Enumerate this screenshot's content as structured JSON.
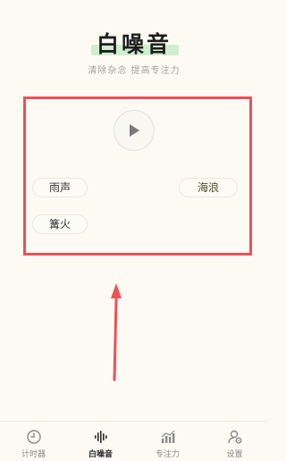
{
  "header": {
    "title": "白噪音",
    "subtitle": "清除杂念 提高专注力"
  },
  "player": {
    "play_icon": "play-icon",
    "sounds": [
      {
        "label": "雨声"
      },
      {
        "label": "海浪"
      },
      {
        "label": "篝火"
      }
    ]
  },
  "annotation": {
    "highlight_color": "#ef4f55"
  },
  "tabbar": {
    "active_tab": "白噪音",
    "tabs": [
      {
        "label": "计时器",
        "icon": "clock-icon"
      },
      {
        "label": "白噪音",
        "icon": "soundwave-icon"
      },
      {
        "label": "专注力",
        "icon": "chart-icon"
      },
      {
        "label": "设置",
        "icon": "user-settings-icon"
      }
    ]
  },
  "colors": {
    "background": "#fdfaf3",
    "title_highlight": "#cfeecf",
    "text_primary": "#1d1d1d",
    "text_secondary": "#a4a19a"
  }
}
